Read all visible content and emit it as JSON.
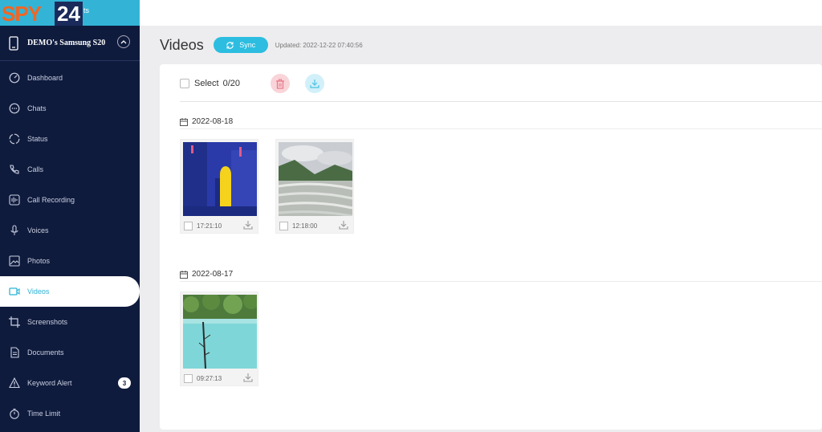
{
  "brand": {
    "logo_text": "SPY",
    "logo_num": "24",
    "logo_small": "ts"
  },
  "device": {
    "name": "DEMO's Samsung S20"
  },
  "nav": [
    {
      "label": "Dashboard",
      "icon": "dashboard-icon"
    },
    {
      "label": "Chats",
      "icon": "chat-icon"
    },
    {
      "label": "Status",
      "icon": "status-icon"
    },
    {
      "label": "Calls",
      "icon": "phone-icon"
    },
    {
      "label": "Call Recording",
      "icon": "audio-wave-icon"
    },
    {
      "label": "Voices",
      "icon": "microphone-icon"
    },
    {
      "label": "Photos",
      "icon": "image-icon"
    },
    {
      "label": "Videos",
      "icon": "video-icon",
      "active": true
    },
    {
      "label": "Screenshots",
      "icon": "crop-icon"
    },
    {
      "label": "Documents",
      "icon": "document-icon"
    },
    {
      "label": "Keyword Alert",
      "icon": "warning-icon",
      "badge": "3"
    },
    {
      "label": "Time Limit",
      "icon": "timer-icon"
    }
  ],
  "header": {
    "title": "Videos",
    "sync_label": "Sync",
    "updated": "Updated: 2022-12-22 07:40:56"
  },
  "toolbar": {
    "select_label": "Select",
    "select_count": "0/20"
  },
  "groups": [
    {
      "date": "2022-08-18",
      "items": [
        {
          "time": "17:21:10"
        },
        {
          "time": "12:18:00"
        }
      ]
    },
    {
      "date": "2022-08-17",
      "items": [
        {
          "time": "09:27:13"
        }
      ]
    }
  ],
  "colors": {
    "accent": "#2cbde0",
    "sidebar": "#0f1b3d",
    "delete": "#f6c9cf",
    "download": "#cdeef8"
  }
}
